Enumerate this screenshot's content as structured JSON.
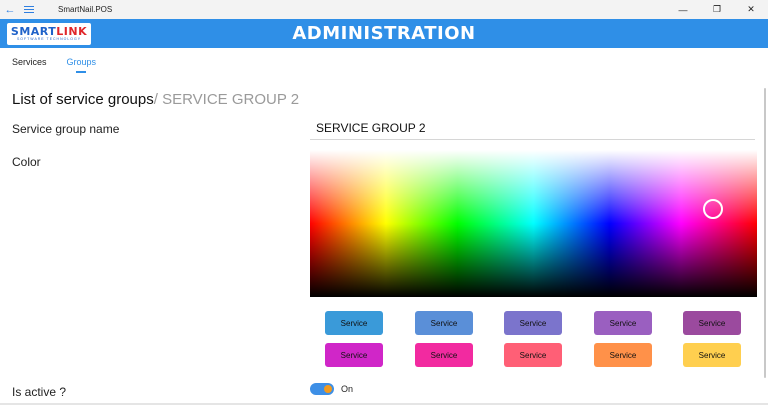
{
  "window": {
    "title": "SmartNail.POS",
    "back_glyph": "←",
    "minimize_glyph": "—",
    "restore_glyph": "❐",
    "close_glyph": "✕"
  },
  "header": {
    "logo_part1": "SMART",
    "logo_part2": "LINK",
    "logo_sub": "SOFTWARE TECHNOLOGY",
    "title": "ADMINISTRATION"
  },
  "tabs": [
    {
      "label": "Services",
      "active": false
    },
    {
      "label": "Groups",
      "active": true
    }
  ],
  "page": {
    "heading": "List of service groups",
    "crumb": "/ SERVICE GROUP 2"
  },
  "form": {
    "name_label": "Service group name",
    "name_value": "SERVICE GROUP 2",
    "color_label": "Color",
    "active_label": "Is active ?",
    "active_state": "On"
  },
  "swatches": [
    {
      "label": "Service",
      "color": "#3a9ad9"
    },
    {
      "label": "Service",
      "color": "#5a8fd8"
    },
    {
      "label": "Service",
      "color": "#7b74cc"
    },
    {
      "label": "Service",
      "color": "#9a5fc0"
    },
    {
      "label": "Service",
      "color": "#9b4a9e"
    },
    {
      "label": "Service",
      "color": "#d026c8"
    },
    {
      "label": "Service",
      "color": "#f22aa0"
    },
    {
      "label": "Service",
      "color": "#ff5f76"
    },
    {
      "label": "Service",
      "color": "#ff9149"
    },
    {
      "label": "Service",
      "color": "#ffcf4f"
    }
  ],
  "colors": {
    "accent": "#2f8fe7",
    "toggle_knob": "#f29a1e"
  }
}
